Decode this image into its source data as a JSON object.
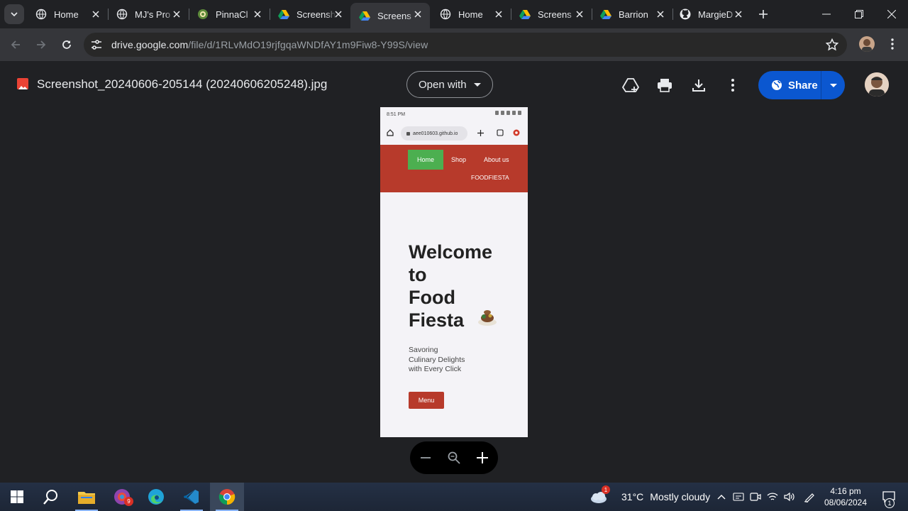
{
  "browser": {
    "tabs": [
      {
        "title": "Home",
        "icon": "globe-icon"
      },
      {
        "title": "MJ's Pro",
        "icon": "globe-icon"
      },
      {
        "title": "PinnaCl",
        "icon": "pinnacle-icon"
      },
      {
        "title": "Screensh",
        "icon": "drive-icon"
      },
      {
        "title": "Screens",
        "icon": "drive-icon",
        "active": true
      },
      {
        "title": "Home",
        "icon": "globe-icon"
      },
      {
        "title": "Screens",
        "icon": "drive-icon"
      },
      {
        "title": "Barrion",
        "icon": "drive-icon"
      },
      {
        "title": "MargieD",
        "icon": "github-icon"
      }
    ],
    "address": {
      "domain": "drive.google.com",
      "path": "/file/d/1RLvMdO19rjfgqaWNDfAY1m9Fiw8-Y99S/view"
    }
  },
  "viewer": {
    "file_name": "Screenshot_20240606-205144 (20240606205248).jpg",
    "open_with_label": "Open with",
    "share_label": "Share"
  },
  "phone": {
    "status_time": "8:51 PM",
    "url": "aee010603.github.io",
    "nav": {
      "home": "Home",
      "shop": "Shop",
      "about": "About us",
      "brand": "FOODFIESTA"
    },
    "hero_title": [
      "Welcome",
      "to",
      "Food",
      "Fiesta"
    ],
    "subtitle": "Savoring Culinary Delights with Every Click",
    "menu_button": "Menu"
  },
  "taskbar": {
    "temperature": "31°C",
    "weather": "Mostly cloudy",
    "weather_badge": "1",
    "time": "4:16 pm",
    "date": "08/06/2024",
    "app_badge": "9",
    "notification_count": "1"
  },
  "colors": {
    "accent_red": "#b73a2b",
    "home_green": "#4caf50",
    "share_blue": "#0b57d0"
  }
}
